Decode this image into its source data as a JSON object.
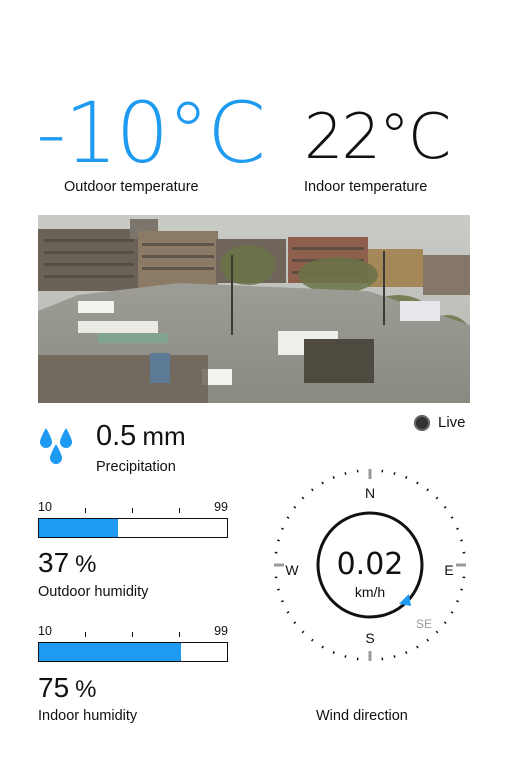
{
  "outdoor": {
    "temperature": "-10°C",
    "label": "Outdoor temperature"
  },
  "indoor": {
    "temperature": "22°C",
    "label": "Indoor temperature"
  },
  "camera": {
    "live_label": "Live"
  },
  "precipitation": {
    "value": "0.5",
    "unit": "mm",
    "label": "Precipitation"
  },
  "outdoor_humidity": {
    "scale_min": "10",
    "scale_max": "99",
    "value": "37",
    "unit": "%",
    "label": "Outdoor humidity",
    "fill_fraction": 0.42
  },
  "indoor_humidity": {
    "scale_min": "10",
    "scale_max": "99",
    "value": "75",
    "unit": "%",
    "label": "Indoor humidity",
    "fill_fraction": 0.755
  },
  "wind": {
    "speed": "0.02",
    "unit": "km/h",
    "label": "Wind direction",
    "north": "N",
    "south": "S",
    "east": "E",
    "west": "W",
    "direction": "SE",
    "bearing_deg": 135
  },
  "colors": {
    "accent": "#1e9bf0",
    "text": "#111111",
    "muted": "#9a9a9a"
  },
  "icons": {
    "precipitation": "raindrops-icon",
    "live": "live-dot-icon"
  }
}
